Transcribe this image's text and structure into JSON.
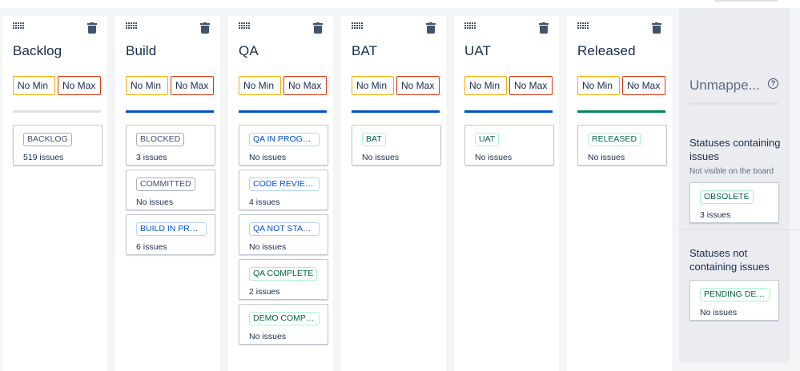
{
  "columns": [
    {
      "title": "Backlog",
      "min": "No Min",
      "max": "No Max",
      "bar_color": "#dfe1e6",
      "cards": [
        {
          "status": "BACKLOG",
          "count": "519 issues",
          "color": "grey"
        }
      ]
    },
    {
      "title": "Build",
      "min": "No Min",
      "max": "No Max",
      "bar_color": "#0052cc",
      "cards": [
        {
          "status": "BLOCKED",
          "count": "3 issues",
          "color": "grey"
        },
        {
          "status": "COMMITTED",
          "count": "No issues",
          "color": "grey"
        },
        {
          "status": "BUILD IN PROG...",
          "count": "6 issues",
          "color": "blue"
        }
      ]
    },
    {
      "title": "QA",
      "min": "No Min",
      "max": "No Max",
      "bar_color": "#0052cc",
      "cards": [
        {
          "status": "QA IN PROGRESS",
          "count": "No issues",
          "color": "blue"
        },
        {
          "status": "CODE REVIEW I...",
          "count": "4 issues",
          "color": "blue"
        },
        {
          "status": "QA NOT STARTED",
          "count": "No issues",
          "color": "blue"
        },
        {
          "status": "QA COMPLETE",
          "count": "2 issues",
          "color": "green"
        },
        {
          "status": "DEMO COMPLE...",
          "count": "No issues",
          "color": "green"
        }
      ]
    },
    {
      "title": "BAT",
      "min": "No Min",
      "max": "No Max",
      "bar_color": "#0052cc",
      "cards": [
        {
          "status": "BAT",
          "count": "No issues",
          "color": "green"
        }
      ]
    },
    {
      "title": "UAT",
      "min": "No Min",
      "max": "No Max",
      "bar_color": "#0052cc",
      "cards": [
        {
          "status": "UAT",
          "count": "No issues",
          "color": "green"
        }
      ]
    },
    {
      "title": "Released",
      "min": "No Min",
      "max": "No Max",
      "bar_color": "#00875a",
      "cards": [
        {
          "status": "RELEASED",
          "count": "No issues",
          "color": "green"
        }
      ]
    }
  ],
  "unmapped": {
    "title": "Unmappe...",
    "with_issues": {
      "title": "Statuses containing issues",
      "subtitle": "Not visible on the board",
      "cards": [
        {
          "status": "OBSOLETE",
          "count": "3 issues",
          "color": "green"
        }
      ]
    },
    "without_issues": {
      "title": "Statuses not containing issues",
      "cards": [
        {
          "status": "PENDING DEMO",
          "count": "No issues",
          "color": "green"
        }
      ]
    }
  },
  "icons": {
    "drag": "drag-handle-icon",
    "delete": "trash-icon",
    "help": "question-circle-icon"
  },
  "colors": {
    "min_border": "#ffab00",
    "max_border": "#de350b",
    "todo_bar": "#dfe1e6",
    "in_progress_bar": "#0052cc",
    "done_bar": "#00875a"
  }
}
